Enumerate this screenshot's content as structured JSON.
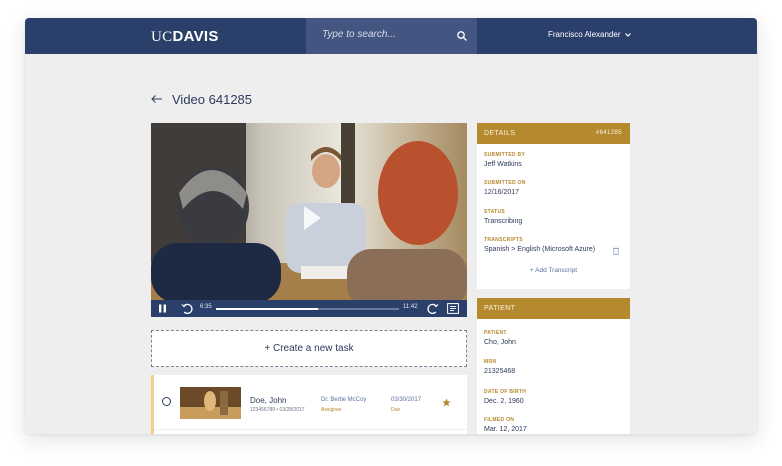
{
  "header": {
    "logo_uc": "UC",
    "logo_davis": "DAVIS",
    "search_placeholder": "Type to search...",
    "user_name": "Francisco Alexander"
  },
  "page": {
    "title": "Video 641285"
  },
  "video": {
    "current_time": "6:35",
    "duration": "11:42",
    "progress": 0.56
  },
  "tasks": {
    "create_label": "+ Create a new task",
    "items": [
      {
        "name": "Doe, John",
        "meta": "123456789 • 03/28/2017",
        "doctor": "Dr. Bertie McCoy",
        "role": "Assignee",
        "date": "03/30/2017",
        "status": "Due"
      }
    ]
  },
  "details": {
    "header": "DETAILS",
    "id": "#641285",
    "submitted_by_label": "SUBMITTED BY",
    "submitted_by": "Jeff Watkins",
    "submitted_on_label": "SUBMITTED ON",
    "submitted_on": "12/16/2017",
    "status_label": "STATUS",
    "status": "Transcribing",
    "transcripts_label": "TRANSCRIPTS",
    "transcript": "Spanish > English (Microsoft Azure)",
    "add_transcript": "+ Add Transcript"
  },
  "patient": {
    "header": "PATIENT",
    "patient_label": "PATIENT",
    "patient": "Cho, John",
    "mrn_label": "MRN",
    "mrn": "21325468",
    "dob_label": "DATE OF BIRTH",
    "dob": "Dec. 2, 1960",
    "filmed_label": "FILMED ON",
    "filmed": "Mar. 12, 2017"
  },
  "colors": {
    "nav": "#2b3f6b",
    "search_bg": "#435580",
    "accent_gold": "#b58a2e",
    "text_navy": "#2d3a5c",
    "highlight": "#f5cf85"
  }
}
